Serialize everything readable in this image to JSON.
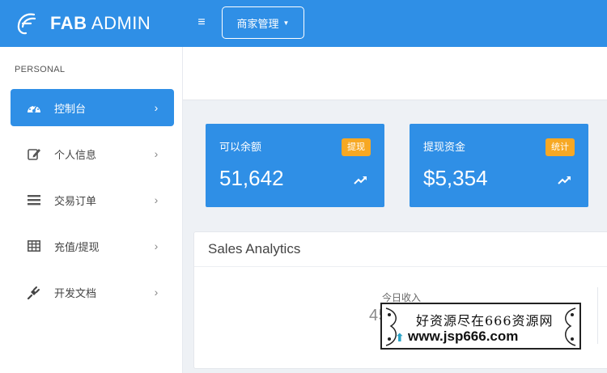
{
  "brand": {
    "bold": "FAB",
    "light": "ADMIN"
  },
  "topbar": {
    "menu_icon": "hamburger-icon",
    "merchant_label": "商家管理"
  },
  "sidebar": {
    "section": "PERSONAL",
    "items": [
      {
        "label": "控制台",
        "icon": "dashboard-icon",
        "active": true
      },
      {
        "label": "个人信息",
        "icon": "edit-icon",
        "active": false
      },
      {
        "label": "交易订单",
        "icon": "list-icon",
        "active": false
      },
      {
        "label": "充值/提现",
        "icon": "table-icon",
        "active": false
      },
      {
        "label": "开发文档",
        "icon": "plug-icon",
        "active": false
      }
    ]
  },
  "cards": [
    {
      "title": "可以余额",
      "badge": "提现",
      "value": "51,642"
    },
    {
      "title": "提现资金",
      "badge": "统计",
      "value": "$5,354"
    }
  ],
  "sales": {
    "title": "Sales Analytics",
    "today_label": "今日收入",
    "today_value": "4554.2"
  },
  "watermark": {
    "line1": "好资源尽在666资源网",
    "line2": "www.jsp666.com"
  },
  "colors": {
    "primary": "#2f8fe6",
    "badge": "#f7a823",
    "background": "#eef1f5"
  }
}
